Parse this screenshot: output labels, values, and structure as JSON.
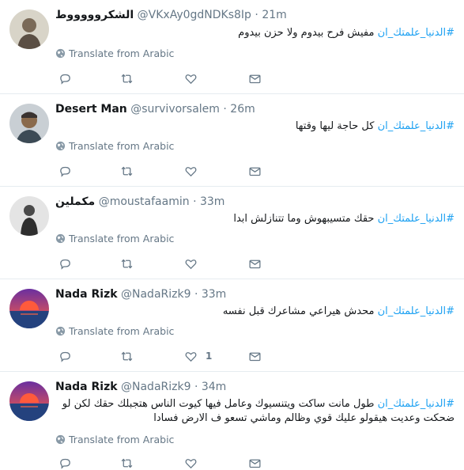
{
  "tweets": [
    {
      "name": "الشكروووووط",
      "handle": "@VKxAy0gdNDKs8Ip",
      "time": "21m",
      "hashtag": "#الدنيا_علمتك_ان",
      "body": " مفيش فرح بيدوم ولا حزن بيدوم",
      "translate": "Translate from Arabic",
      "likes": ""
    },
    {
      "name": "Desert Man",
      "handle": "@survivorsalem",
      "time": "26m",
      "hashtag": "#الدنيا_علمتك_ان",
      "body": " كل حاجة ليها وقتها",
      "translate": "Translate from Arabic",
      "likes": ""
    },
    {
      "name": "مكملين",
      "handle": "@moustafaamin",
      "time": "33m",
      "hashtag": "#الدنيا_علمتك_ان",
      "body": " حقك متسيبهوش وما تتنازلش ابدا",
      "translate": "Translate from Arabic",
      "likes": ""
    },
    {
      "name": "Nada Rizk",
      "handle": "@NadaRizk9",
      "time": "33m",
      "hashtag": "#الدنيا_علمتك_ان",
      "body": " محدش هيراعي مشاعرك قبل نفسه",
      "translate": "Translate from Arabic",
      "likes": "1"
    },
    {
      "name": "Nada Rizk",
      "handle": "@NadaRizk9",
      "time": "34m",
      "hashtag": "#الدنيا_علمتك_ان",
      "body": " طول مانت ساكت ويتنسيوك وعامل فيها كيوت الناس هتجبلك حقك لكن لو ضحكت وعديت هيقولو عليك قوي وظالم وماشي تسعو ف الارض فسادا",
      "translate": "Translate from Arabic",
      "likes": ""
    }
  ],
  "separator": "·",
  "colors": {
    "link": "#1da1f2",
    "muted": "#657786",
    "border": "#e6ecf0"
  }
}
